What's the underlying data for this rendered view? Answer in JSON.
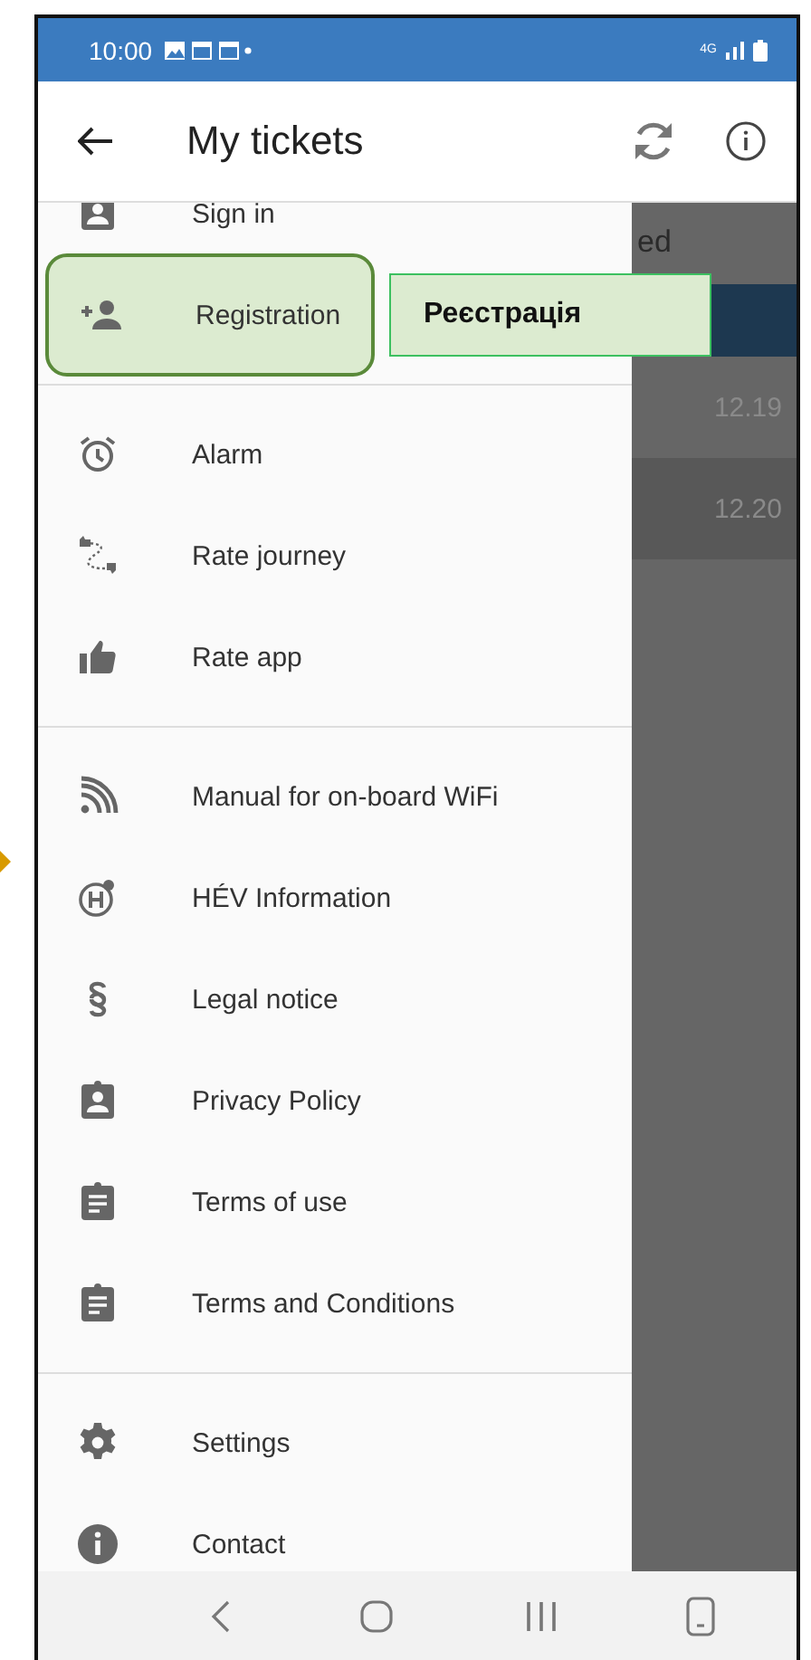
{
  "status_bar": {
    "time": "10:00",
    "network": "4G"
  },
  "app_bar": {
    "title": "My tickets"
  },
  "background": {
    "header": "ed",
    "rows": [
      {
        "time": "12.19",
        "selected": false
      },
      {
        "time": "12.20",
        "selected": true
      }
    ]
  },
  "drawer": {
    "sections": [
      {
        "items": [
          {
            "label": "Sign in",
            "highlighted": false
          },
          {
            "label": "Registration",
            "highlighted": true
          }
        ]
      },
      {
        "items": [
          {
            "label": "Alarm",
            "highlighted": false
          },
          {
            "label": "Rate journey",
            "highlighted": false
          },
          {
            "label": "Rate app",
            "highlighted": false
          }
        ]
      },
      {
        "items": [
          {
            "label": "Manual for on-board WiFi",
            "highlighted": false
          },
          {
            "label": "HÉV Information",
            "highlighted": false
          },
          {
            "label": "Legal notice",
            "highlighted": false
          },
          {
            "label": "Privacy Policy",
            "highlighted": false
          },
          {
            "label": "Terms of use",
            "highlighted": false
          },
          {
            "label": "Terms and Conditions",
            "highlighted": false
          }
        ]
      },
      {
        "items": [
          {
            "label": "Settings",
            "highlighted": false
          },
          {
            "label": "Contact",
            "highlighted": false
          }
        ]
      }
    ]
  },
  "callout": {
    "text": "Реєстрація"
  }
}
